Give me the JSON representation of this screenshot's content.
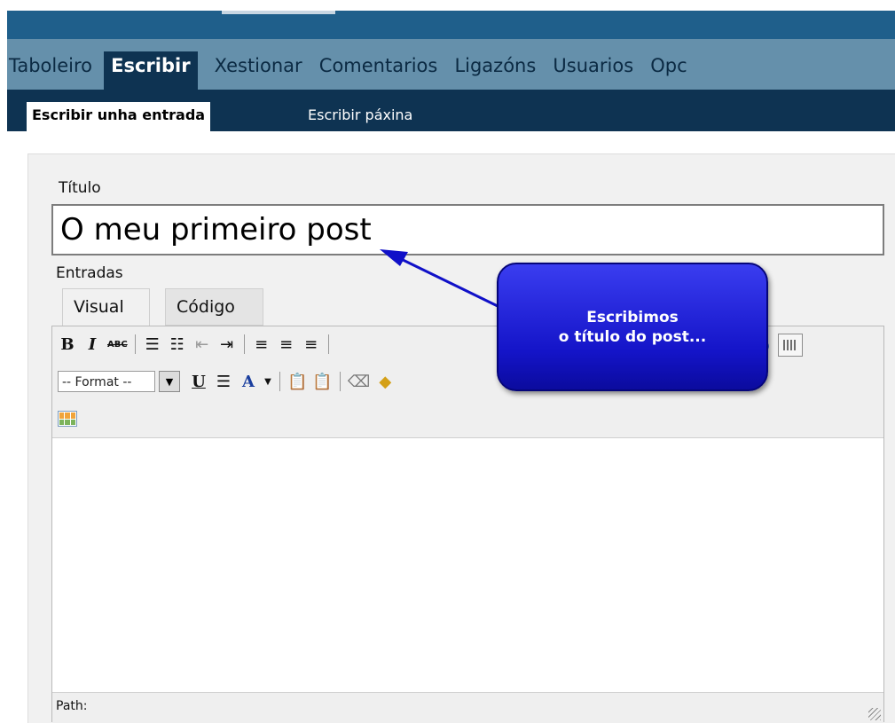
{
  "nav": {
    "items": [
      "Taboleiro",
      "Escribir",
      "Xestionar",
      "Comentarios",
      "Ligazóns",
      "Usuarios",
      "Opc"
    ],
    "active": "Escribir"
  },
  "subnav": {
    "items": [
      "Escribir unha entrada",
      "Escribir páxina"
    ]
  },
  "form": {
    "title_label": "Título",
    "title_value": "O meu primeiro post",
    "entries_label": "Entradas"
  },
  "editor": {
    "tabs": [
      "Visual",
      "Código"
    ],
    "format_select": "-- Format --",
    "status_label": "Path:"
  },
  "callout": {
    "line1": "Escribimos",
    "line2": "o título do post..."
  },
  "colors": {
    "header": "#1f5f8b",
    "nav": "#6590ab",
    "subnav": "#0e3352",
    "callout": "#1c1cd6"
  }
}
